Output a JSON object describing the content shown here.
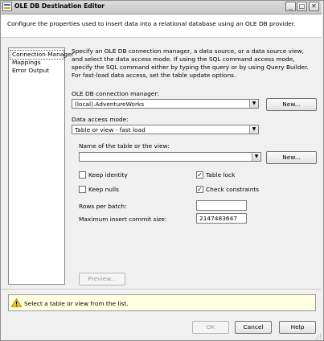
{
  "window": {
    "title": "OLE DB Destination Editor",
    "caption_buttons": {
      "minimize": "_",
      "maximize": "□",
      "close": "✕"
    }
  },
  "header": {
    "description": "Configure the properties used to insert data into a relational database using an OLE DB provider."
  },
  "nav": {
    "items": [
      {
        "label": "Connection Manager",
        "selected": true
      },
      {
        "label": "Mappings",
        "selected": false
      },
      {
        "label": "Error Output",
        "selected": false
      }
    ]
  },
  "main": {
    "intro": "Specify an OLE DB connection manager, a data source, or a data source view, and select the data access mode. If using the SQL command access mode, specify the SQL command either by typing the query or by using Query Builder. For fast-load data access, set the table update options.",
    "connection_manager": {
      "label": "OLE DB connection manager:",
      "value": "(local).AdventureWorks",
      "new_button": "New..."
    },
    "data_access_mode": {
      "label": "Data access mode:",
      "value": "Table or view - fast load"
    },
    "table_name": {
      "label": "Name of the table or the view:",
      "value": "",
      "new_button": "New..."
    },
    "options": {
      "keep_identity": {
        "label": "Keep identity",
        "checked": false
      },
      "table_lock": {
        "label": "Table lock",
        "checked": true
      },
      "keep_nulls": {
        "label": "Keep nulls",
        "checked": false
      },
      "check_constraints": {
        "label": "Check constraints",
        "checked": true
      }
    },
    "rows_per_batch": {
      "label": "Rows per batch:",
      "value": ""
    },
    "max_insert_commit": {
      "label": "Maximum insert commit size:",
      "value": "2147483647"
    },
    "preview_button": "Preview..."
  },
  "status": {
    "message": "Select a table or view from the list.",
    "icon": "warning-icon",
    "color": "#ffffe1"
  },
  "footer": {
    "ok_label": "OK",
    "cancel_label": "Cancel",
    "help_label": "Help"
  },
  "check_glyph": "✓"
}
